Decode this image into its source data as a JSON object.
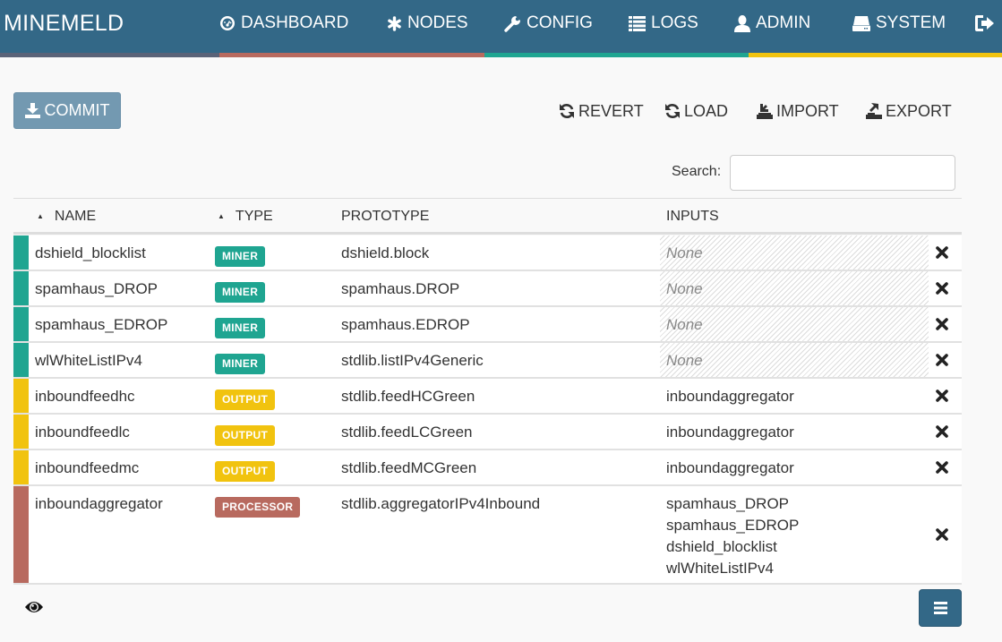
{
  "navbar": {
    "brand": "MINEMELD",
    "items": [
      {
        "label": "DASHBOARD",
        "icon": "dashboard-icon"
      },
      {
        "label": "NODES",
        "icon": "asterisk-icon"
      },
      {
        "label": "CONFIG",
        "icon": "wrench-icon"
      },
      {
        "label": "LOGS",
        "icon": "list-icon"
      },
      {
        "label": "ADMIN",
        "icon": "user-icon"
      },
      {
        "label": "SYSTEM",
        "icon": "hdd-icon"
      }
    ],
    "logout_icon": "logout-icon",
    "strip_colors": [
      "#5a6378",
      "#b86a5f",
      "#1fa591",
      "#f1c30f"
    ]
  },
  "toolbar": {
    "commit_label": "COMMIT",
    "revert_label": "REVERT",
    "load_label": "LOAD",
    "import_label": "IMPORT",
    "export_label": "EXPORT"
  },
  "search": {
    "label": "Search:",
    "value": "",
    "placeholder": ""
  },
  "table": {
    "columns": [
      "NAME",
      "TYPE",
      "PROTOTYPE",
      "INPUTS"
    ],
    "rows": [
      {
        "name": "dshield_blocklist",
        "type": "MINER",
        "prototype": "dshield.block",
        "inputs": [],
        "inputs_empty_label": "None"
      },
      {
        "name": "spamhaus_DROP",
        "type": "MINER",
        "prototype": "spamhaus.DROP",
        "inputs": [],
        "inputs_empty_label": "None"
      },
      {
        "name": "spamhaus_EDROP",
        "type": "MINER",
        "prototype": "spamhaus.EDROP",
        "inputs": [],
        "inputs_empty_label": "None"
      },
      {
        "name": "wlWhiteListIPv4",
        "type": "MINER",
        "prototype": "stdlib.listIPv4Generic",
        "inputs": [],
        "inputs_empty_label": "None"
      },
      {
        "name": "inboundfeedhc",
        "type": "OUTPUT",
        "prototype": "stdlib.feedHCGreen",
        "inputs": [
          "inboundaggregator"
        ]
      },
      {
        "name": "inboundfeedlc",
        "type": "OUTPUT",
        "prototype": "stdlib.feedLCGreen",
        "inputs": [
          "inboundaggregator"
        ]
      },
      {
        "name": "inboundfeedmc",
        "type": "OUTPUT",
        "prototype": "stdlib.feedMCGreen",
        "inputs": [
          "inboundaggregator"
        ]
      },
      {
        "name": "inboundaggregator",
        "type": "PROCESSOR",
        "prototype": "stdlib.aggregatorIPv4Inbound",
        "inputs": [
          "spamhaus_DROP",
          "spamhaus_EDROP",
          "dshield_blocklist",
          "wlWhiteListIPv4"
        ]
      }
    ]
  },
  "type_colors": {
    "MINER": "#1fa591",
    "OUTPUT": "#f1c30f",
    "PROCESSOR": "#b86a5f"
  },
  "footer": {
    "eye_icon": "eye-icon",
    "menu_icon": "hamburger-icon"
  }
}
